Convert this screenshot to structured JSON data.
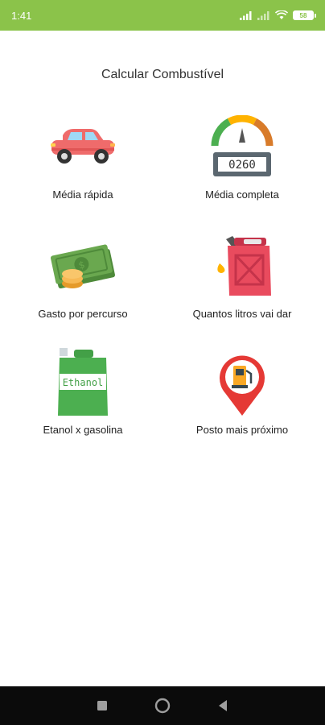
{
  "status_bar": {
    "time": "1:41",
    "battery": "58"
  },
  "page": {
    "title": "Calcular Combustível"
  },
  "menu": {
    "items": [
      {
        "label": "Média rápida",
        "icon": "car-icon"
      },
      {
        "label": "Média completa",
        "icon": "fuel-gauge-icon"
      },
      {
        "label": "Gasto por percurso",
        "icon": "money-icon"
      },
      {
        "label": "Quantos litros vai dar",
        "icon": "fuel-can-icon"
      },
      {
        "label": "Etanol x gasolina",
        "icon": "ethanol-can-icon"
      },
      {
        "label": "Posto mais próximo",
        "icon": "gas-station-pin-icon"
      }
    ],
    "odometer": "0260",
    "ethanol_text": "Ethanol"
  },
  "colors": {
    "status_bar": "#8bc34a",
    "nav_bar": "#0b0b0b"
  }
}
